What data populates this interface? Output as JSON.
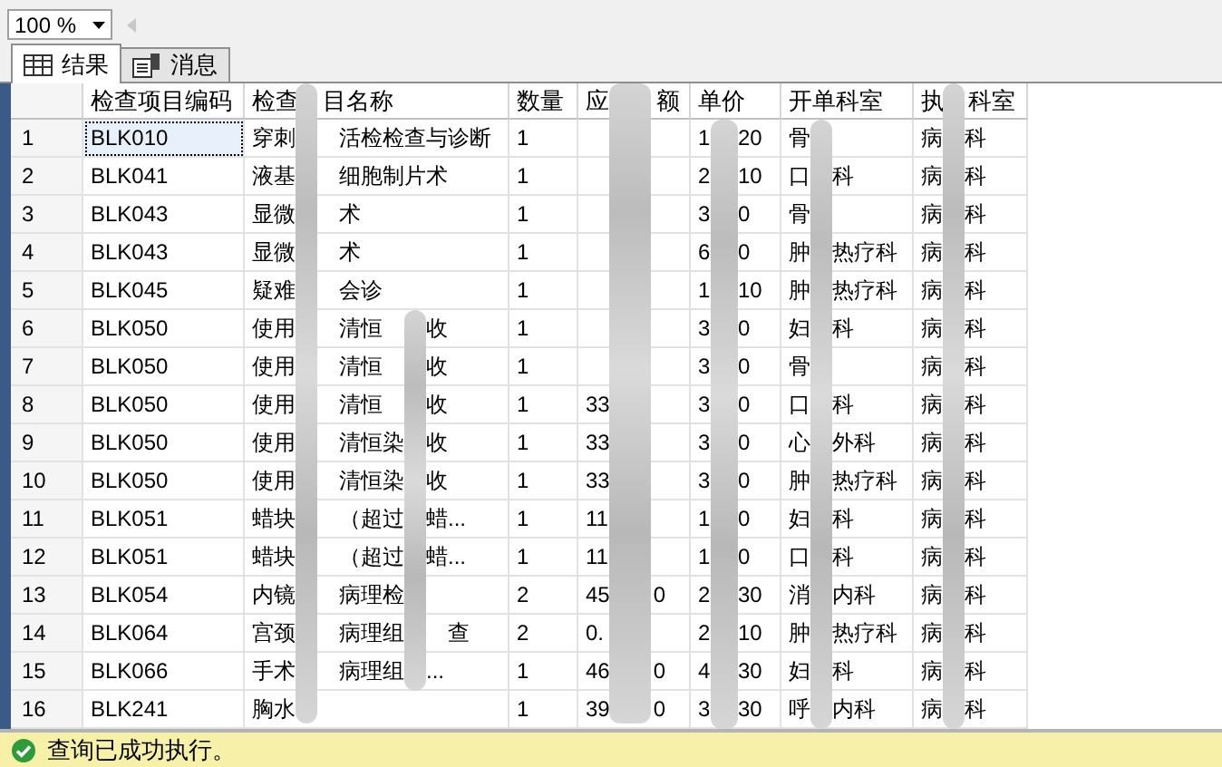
{
  "zoom": {
    "value": "100 %"
  },
  "tabs": [
    {
      "label": "结果",
      "kind": "grid",
      "selected": true
    },
    {
      "label": "消息",
      "kind": "messages",
      "selected": false
    }
  ],
  "grid": {
    "columns": [
      "检查项目编码",
      "检查　目名称",
      "数量",
      "应　　额",
      "单价",
      "开单科室",
      "执　科室"
    ],
    "rows": [
      {
        "number": "1",
        "code": "BLK010",
        "name": "穿刺　　活检检查与诊断",
        "quantity": "1",
        "price": "1　 20",
        "dept": "骨",
        "exec": "病　科",
        "selected": true
      },
      {
        "number": "2",
        "code": "BLK041",
        "name": "液基　　细胞制片术",
        "quantity": "1",
        "price": "2　 10",
        "dept": "口　科",
        "exec": "病　科",
        "selected": false
      },
      {
        "number": "3",
        "code": "BLK043",
        "name": "显微　　术",
        "quantity": "1",
        "price": "3　 0",
        "dept": "骨",
        "exec": "病　科",
        "selected": false
      },
      {
        "number": "4",
        "code": "BLK043",
        "name": "显微　　术",
        "quantity": "1",
        "price": "6　 0",
        "dept": "肿　热疗科",
        "exec": "病　科",
        "selected": false
      },
      {
        "number": "5",
        "code": "BLK045",
        "name": "疑难　　会诊",
        "quantity": "1",
        "price": "1　 10",
        "dept": "肿　热疗科",
        "exec": "病　科",
        "selected": false
      },
      {
        "number": "6",
        "code": "BLK050",
        "name": "使用　　清恒　　收",
        "quantity": "1",
        "price": "3　 0",
        "dept": "妇　科",
        "exec": "病　科",
        "selected": false
      },
      {
        "number": "7",
        "code": "BLK050",
        "name": "使用　　清恒　　收",
        "quantity": "1",
        "price": "3　 0",
        "dept": "骨",
        "exec": "病　科",
        "selected": false
      },
      {
        "number": "8",
        "code": "BLK050",
        "name": "使用　　清恒　　收",
        "quantity": "1",
        "amount": "33",
        "price": "3　 0",
        "dept": "口　科",
        "exec": "病　科",
        "selected": false
      },
      {
        "number": "9",
        "code": "BLK050",
        "name": "使用　　清恒染　收",
        "quantity": "1",
        "amount": "33",
        "price": "3　 0",
        "dept": "心　外科",
        "exec": "病　科",
        "selected": false
      },
      {
        "number": "10",
        "code": "BLK050",
        "name": "使用　　清恒染　收",
        "quantity": "1",
        "amount": "33",
        "price": "3　 0",
        "dept": "肿　热疗科",
        "exec": "病　科",
        "selected": false
      },
      {
        "number": "11",
        "code": "BLK051",
        "name": "蜡块　　（超过　蜡...",
        "quantity": "1",
        "amount": "11",
        "price": "1　 0",
        "dept": "妇　科",
        "exec": "病　科",
        "selected": false
      },
      {
        "number": "12",
        "code": "BLK051",
        "name": "蜡块　　（超过　蜡...",
        "quantity": "1",
        "amount": "11",
        "price": "1　 0",
        "dept": "口　科",
        "exec": "病　科",
        "selected": false
      },
      {
        "number": "13",
        "code": "BLK054",
        "name": "内镜　　病理检",
        "quantity": "2",
        "amount": "45　　0",
        "price": "2　 30",
        "dept": "消　内科",
        "exec": "病　科",
        "selected": false
      },
      {
        "number": "14",
        "code": "BLK064",
        "name": "宫颈　　病理组　　查",
        "quantity": "2",
        "amount": "0.",
        "price": "2　 10",
        "dept": "肿　热疗科",
        "exec": "病　科",
        "selected": false
      },
      {
        "number": "15",
        "code": "BLK066",
        "name": "手术　　病理组　...",
        "quantity": "1",
        "amount": "46　　0",
        "price": "4　 30",
        "dept": "妇　科",
        "exec": "病　科",
        "selected": false
      },
      {
        "number": "16",
        "code": "BLK241",
        "name": "胸水",
        "quantity": "1",
        "amount": "39　　0",
        "price": "3　 30",
        "dept": "呼　内科",
        "exec": "病　科",
        "selected": false
      }
    ]
  },
  "status_bar": {
    "text": "查询已成功执行。",
    "kind": "success"
  }
}
